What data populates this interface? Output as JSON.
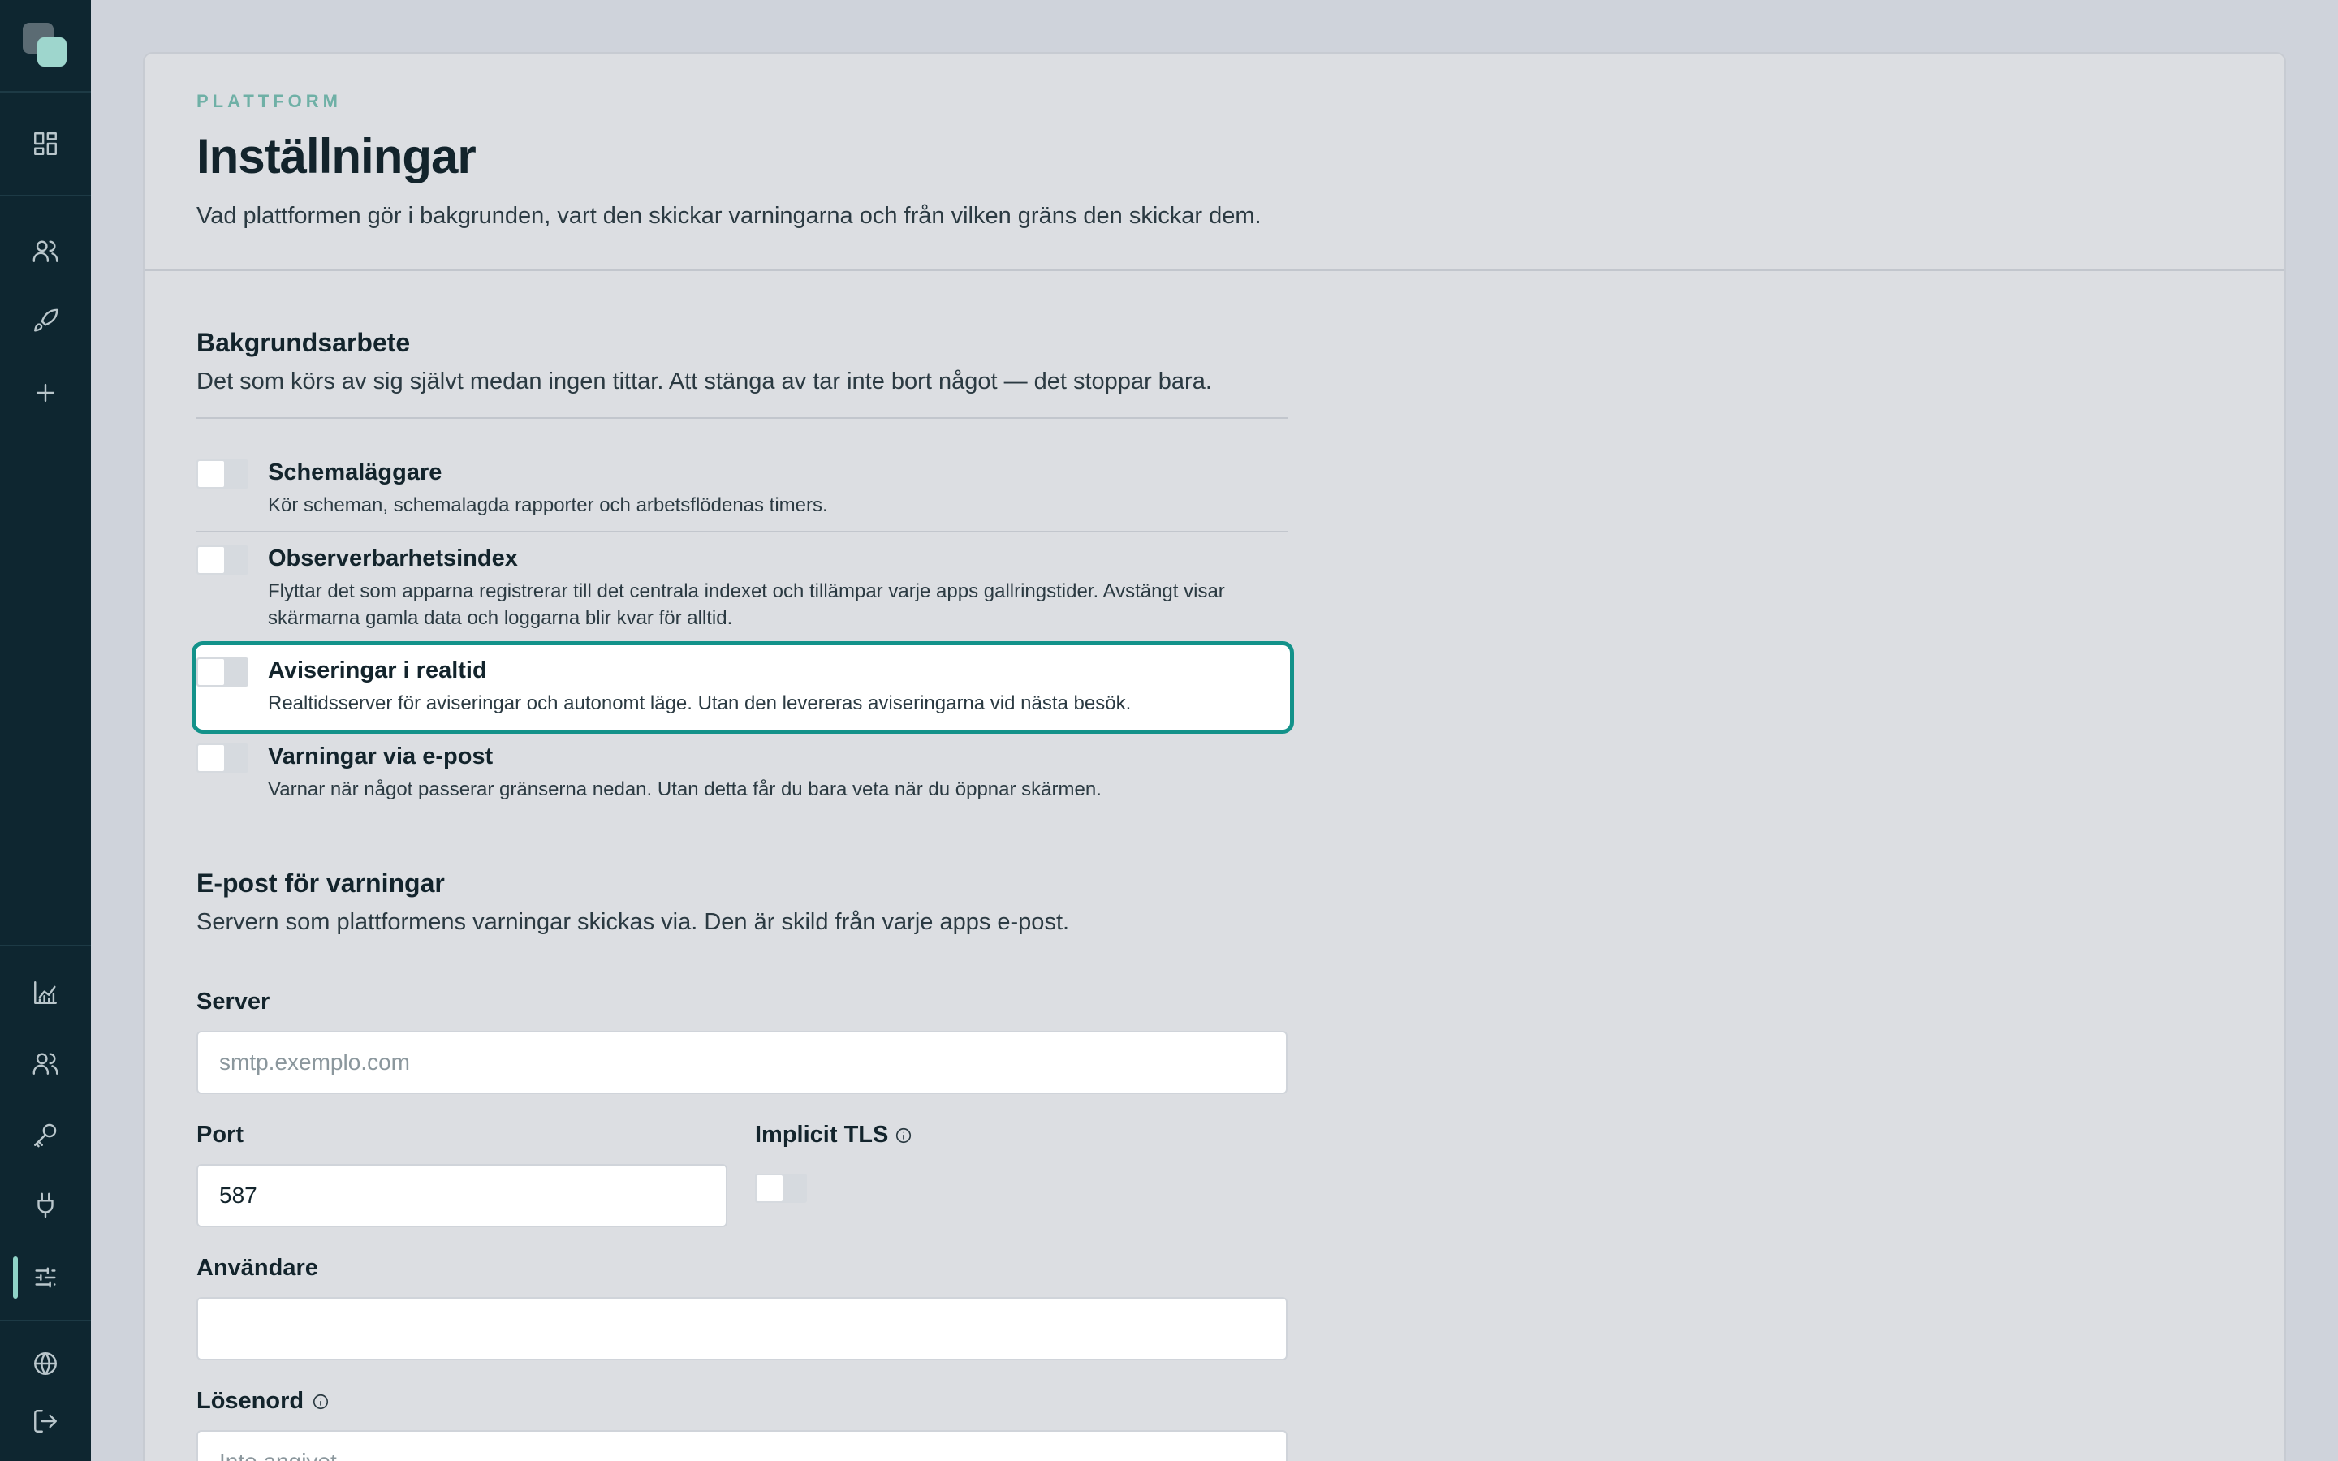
{
  "header": {
    "eyebrow": "PLATTFORM",
    "title": "Inställningar",
    "description": "Vad plattformen gör i bakgrunden, vart den skickar varningarna och från vilken gräns den skickar dem."
  },
  "sidebar": {
    "top_icons": [
      "dashboard-icon",
      "users-icon",
      "rocket-icon",
      "plus-icon"
    ],
    "bottom_icons": [
      "chart-icon",
      "team-icon",
      "key-icon",
      "plug-icon",
      "sliders-icon",
      "globe-icon",
      "logout-icon"
    ],
    "active": "sliders-icon"
  },
  "background_jobs": {
    "title": "Bakgrundsarbete",
    "description": "Det som körs av sig självt medan ingen tittar. Att stänga av tar inte bort något — det stoppar bara.",
    "items": [
      {
        "title": "Schemaläggare",
        "description": "Kör scheman, schemalagda rapporter och arbetsflödenas timers.",
        "enabled": false
      },
      {
        "title": "Observerbarhetsindex",
        "description": "Flyttar det som apparna registrerar till det centrala indexet och tillämpar varje apps gallringstider. Avstängt visar skärmarna gamla data och loggarna blir kvar för alltid.",
        "enabled": false
      },
      {
        "title": "Aviseringar i realtid",
        "description": "Realtidsserver för aviseringar och autonomt läge. Utan den levereras aviseringarna vid nästa besök.",
        "enabled": false
      },
      {
        "title": "Varningar via e-post",
        "description": "Varnar när något passerar gränserna nedan. Utan detta får du bara veta när du öppnar skärmen.",
        "enabled": false
      }
    ]
  },
  "email": {
    "title": "E-post för varningar",
    "description": "Servern som plattformens varningar skickas via. Den är skild från varje apps e-post.",
    "server_label": "Server",
    "server_placeholder": "smtp.exemplo.com",
    "server_value": "",
    "port_label": "Port",
    "port_value": "587",
    "tls_label": "Implicit TLS",
    "tls_enabled": false,
    "user_label": "Användare",
    "user_value": "",
    "password_label": "Lösenord",
    "password_placeholder": "Inte angivet"
  }
}
